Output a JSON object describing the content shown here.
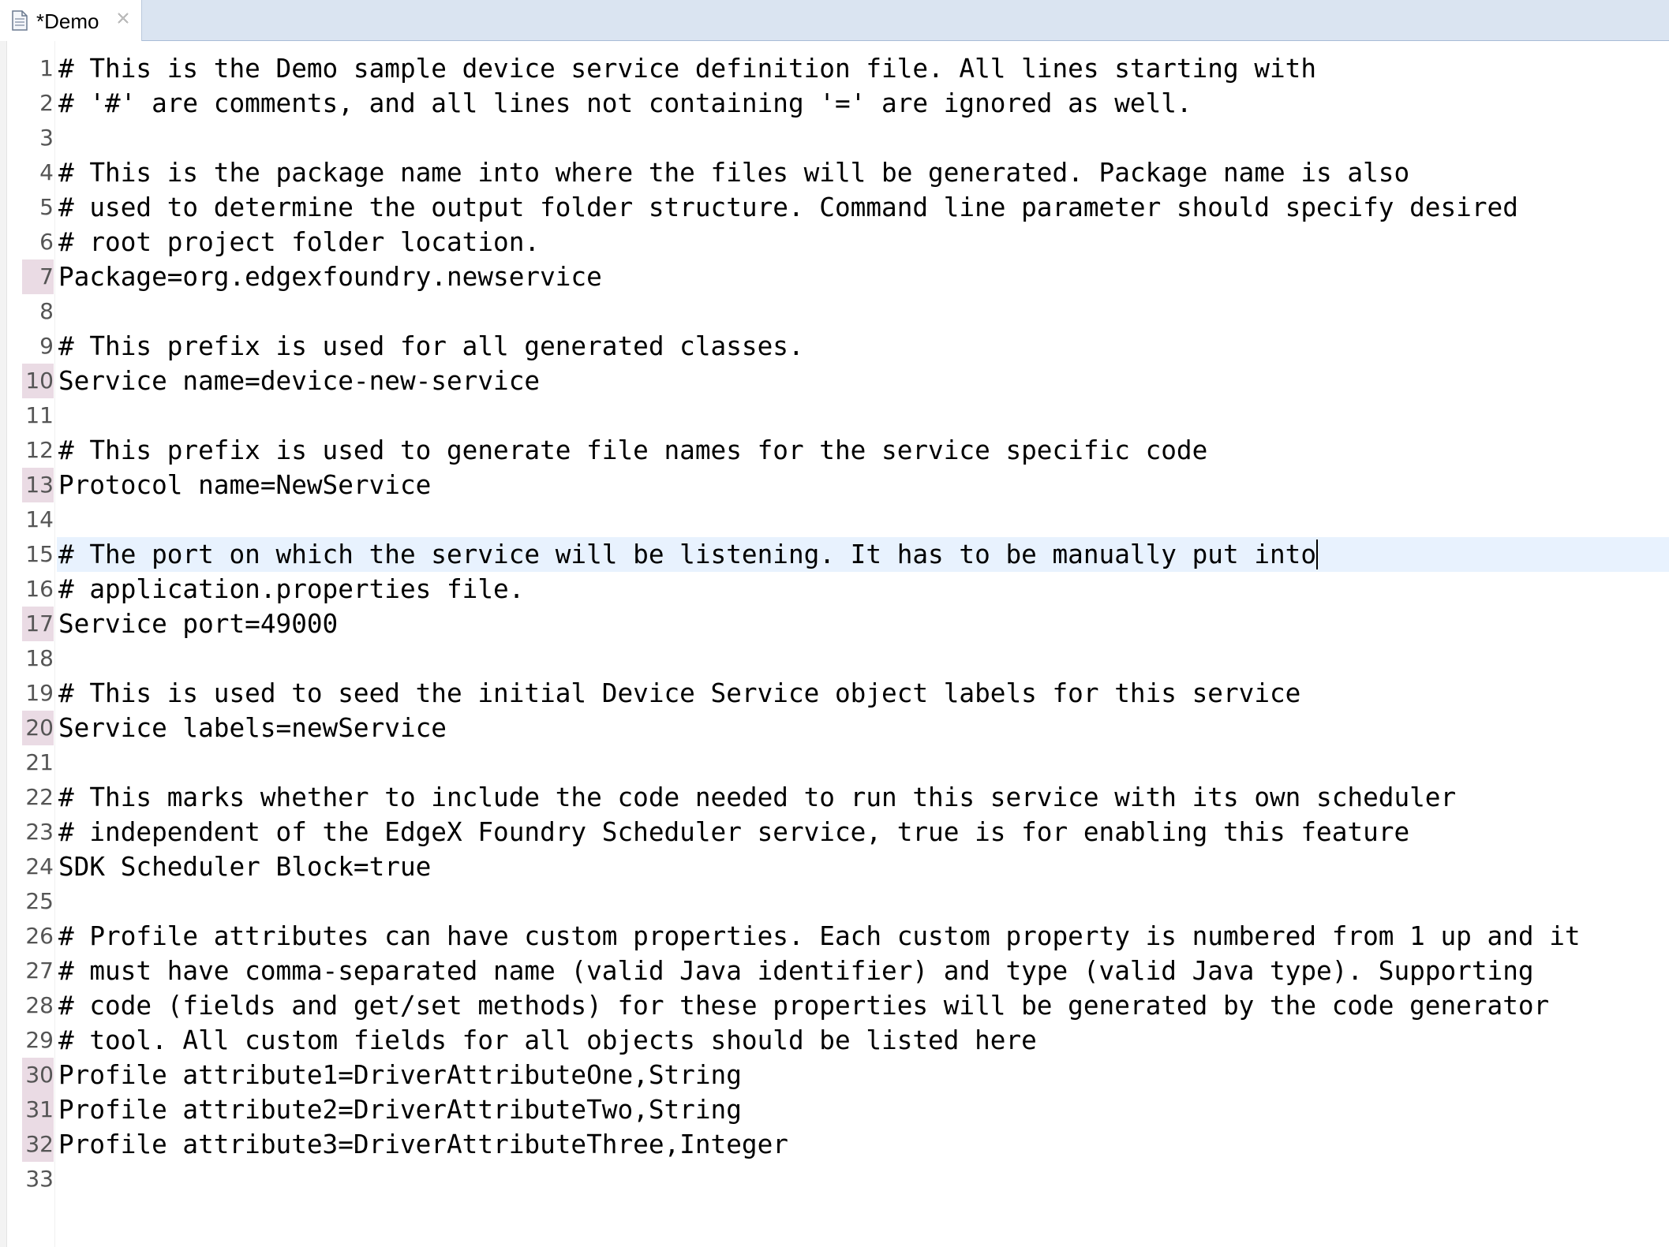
{
  "tab": {
    "title": "*Demo",
    "icon": "text-file-icon",
    "close_icon": "close-icon"
  },
  "colors": {
    "tabbar_bg": "#dae4f1",
    "current_line_bg": "#e8f2fe",
    "changed_line_marker": "#eadbe4",
    "line_number_text": "#555555"
  },
  "editor": {
    "lines": [
      {
        "num": "1",
        "text": "# This is the Demo sample device service definition file. All lines starting with",
        "changed": false
      },
      {
        "num": "2",
        "text": "# '#' are comments, and all lines not containing '=' are ignored as well.",
        "changed": false
      },
      {
        "num": "3",
        "text": "",
        "changed": false
      },
      {
        "num": "4",
        "text": "# This is the package name into where the files will be generated. Package name is also",
        "changed": false
      },
      {
        "num": "5",
        "text": "# used to determine the output folder structure. Command line parameter should specify desired",
        "changed": false
      },
      {
        "num": "6",
        "text": "# root project folder location.",
        "changed": false
      },
      {
        "num": "7",
        "text": "Package=org.edgexfoundry.newservice",
        "changed": true
      },
      {
        "num": "8",
        "text": "",
        "changed": false
      },
      {
        "num": "9",
        "text": "# This prefix is used for all generated classes.",
        "changed": false
      },
      {
        "num": "10",
        "text": "Service name=device-new-service",
        "changed": true
      },
      {
        "num": "11",
        "text": "",
        "changed": false
      },
      {
        "num": "12",
        "text": "# This prefix is used to generate file names for the service specific code",
        "changed": false
      },
      {
        "num": "13",
        "text": "Protocol name=NewService",
        "changed": true
      },
      {
        "num": "14",
        "text": "",
        "changed": false
      },
      {
        "num": "15",
        "text": "# The port on which the service will be listening. It has to be manually put into",
        "changed": false,
        "current": true
      },
      {
        "num": "16",
        "text": "# application.properties file.",
        "changed": false
      },
      {
        "num": "17",
        "text": "Service port=49000",
        "changed": true
      },
      {
        "num": "18",
        "text": "",
        "changed": false
      },
      {
        "num": "19",
        "text": "# This is used to seed the initial Device Service object labels for this service",
        "changed": false
      },
      {
        "num": "20",
        "text": "Service labels=newService",
        "changed": true
      },
      {
        "num": "21",
        "text": "",
        "changed": false
      },
      {
        "num": "22",
        "text": "# This marks whether to include the code needed to run this service with its own scheduler",
        "changed": false
      },
      {
        "num": "23",
        "text": "# independent of the EdgeX Foundry Scheduler service, true is for enabling this feature",
        "changed": false
      },
      {
        "num": "24",
        "text": "SDK Scheduler Block=true",
        "changed": false
      },
      {
        "num": "25",
        "text": "",
        "changed": false
      },
      {
        "num": "26",
        "text": "# Profile attributes can have custom properties. Each custom property is numbered from 1 up and it",
        "changed": false
      },
      {
        "num": "27",
        "text": "# must have comma-separated name (valid Java identifier) and type (valid Java type). Supporting",
        "changed": false
      },
      {
        "num": "28",
        "text": "# code (fields and get/set methods) for these properties will be generated by the code generator",
        "changed": false
      },
      {
        "num": "29",
        "text": "# tool. All custom fields for all objects should be listed here",
        "changed": false
      },
      {
        "num": "30",
        "text": "Profile attribute1=DriverAttributeOne,String",
        "changed": true
      },
      {
        "num": "31",
        "text": "Profile attribute2=DriverAttributeTwo,String",
        "changed": true
      },
      {
        "num": "32",
        "text": "Profile attribute3=DriverAttributeThree,Integer",
        "changed": true
      },
      {
        "num": "33",
        "text": "",
        "changed": false
      }
    ]
  }
}
